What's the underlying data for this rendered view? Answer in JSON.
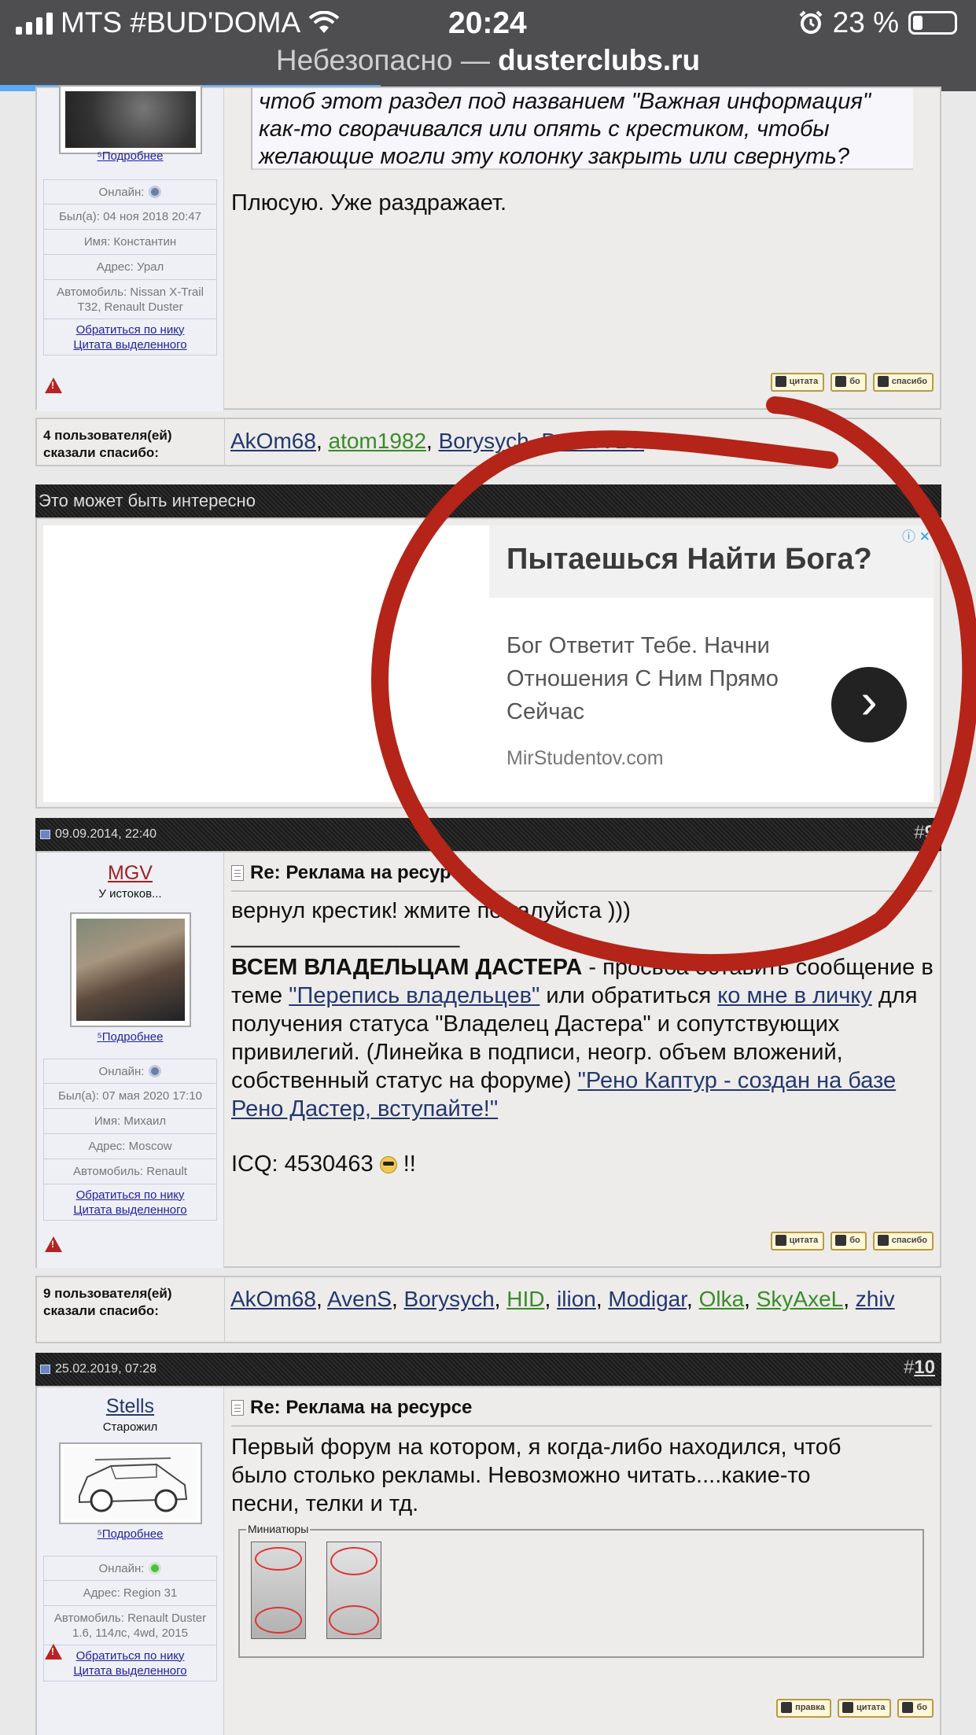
{
  "status_bar": {
    "carrier": "MTS #BUD'DOMA",
    "time": "20:24",
    "battery": "23 %"
  },
  "browser": {
    "security": "Небезопасно —",
    "domain": "dusterclubs.ru",
    "progress": 0.39
  },
  "colors": {
    "status_bg": "#4e4e50",
    "progress": "#5ba9f5",
    "header_bg": "#222222",
    "annotation_red": "#b42418",
    "link_blue": "#24376f",
    "link_green": "#3a8b2a"
  },
  "post8": {
    "more_link": "Подробнее",
    "info": [
      "Онлайн:",
      "Был(а): 04 ноя 2018 20:47",
      "Имя: Константин",
      "Адрес: Урал",
      "Автомобиль: Nissan X-Trail T32, Renault Duster"
    ],
    "links": [
      "Обратиться по нику",
      "Цитата выделенного"
    ],
    "quote_lines": [
      "чтоб этот раздел под названием \"Важная информация\"",
      "как-то сворачивался или опять с крестиком, чтобы",
      "желающие могли эту колонку закрыть или свернуть?"
    ],
    "body": "Плюсую. Уже раздражает.",
    "buttons": [
      "цитата",
      "бо",
      "спасибо"
    ]
  },
  "thanks8": {
    "label_line1": "4 пользователя(ей)",
    "label_line2": "сказали спасибо:",
    "names": [
      "AkOm68",
      "atom1982",
      "Borysych",
      "DozorVLG"
    ]
  },
  "interesting": {
    "header": "Это может быть интересно"
  },
  "ad": {
    "title": "Пытаешься Найти Бога?",
    "text_lines": [
      "Бог Ответит Тебе. Начни",
      "Отношения С Ним Прямо",
      "Сейчас"
    ],
    "domain": "MirStudentov.com",
    "adchoices": "ⓘ ✕",
    "arrow": "›"
  },
  "post9": {
    "date": "09.09.2014, 22:40",
    "number_prefix": "#",
    "number": "9",
    "username": "MGV",
    "rank": "У истоков...",
    "more_link": "Подробнее",
    "info": [
      "Онлайн:",
      "Был(а): 07 мая 2020 17:10",
      "Имя: Михаил",
      "Адрес: Moscow",
      "Автомобиль: Renault"
    ],
    "links": [
      "Обратиться по нику",
      "Цитата выделенного"
    ],
    "title": "Re: Реклама на ресурсе",
    "line1": "вернул крестик! жмите пожалуйста )))",
    "separator": "__________________",
    "sig_bold": "ВСЕМ ВЛАДЕЛЬЦАМ ДАСТЕРА",
    "sig_1": " - просьба оставить сообщение в теме ",
    "sig_link1": "\"Перепись владельцев\"",
    "sig_2": " или обратиться ",
    "sig_link2": "ко мне в личку",
    "sig_3": " для получения статуса \"Владелец Дастера\" и сопутствующих привилегий. (Линейка в подписи, неогр. объем вложений, собственный статус на форуме) ",
    "sig_link3": "\"Рено Каптур - создан на базе Рено Дастер, вступайте!\"",
    "icq": "ICQ: 4530463",
    "icq_end": " !!",
    "buttons": [
      "цитата",
      "бо",
      "спасибо"
    ]
  },
  "thanks9": {
    "label_line1": "9 пользователя(ей)",
    "label_line2": "сказали спасибо:",
    "names": [
      "AkOm68",
      "AvenS",
      "Borysych",
      "HID",
      "ilion",
      "Modigar",
      "Olka",
      "SkyAxeL",
      "zhiv"
    ]
  },
  "post10": {
    "date": "25.02.2019, 07:28",
    "number_prefix": "#",
    "number": "10",
    "username": "Stells",
    "rank": "Старожил",
    "more_link": "Подробнее",
    "info": [
      "Онлайн:",
      "Адрес: Region 31",
      "Автомобиль: Renault Duster 1.6, 114лс, 4wd, 2015"
    ],
    "links": [
      "Обратиться по нику",
      "Цитата выделенного"
    ],
    "title": "Re: Реклама на ресурсе",
    "body_lines": [
      "Первый форум на котором, я когда-либо находился, чтоб",
      "было столько рекламы. Невозможно читать....какие-то",
      "песни, телки и тд."
    ],
    "thumbs_label": "Миниатюры",
    "buttons": [
      "правка",
      "цитата",
      "бо"
    ]
  }
}
